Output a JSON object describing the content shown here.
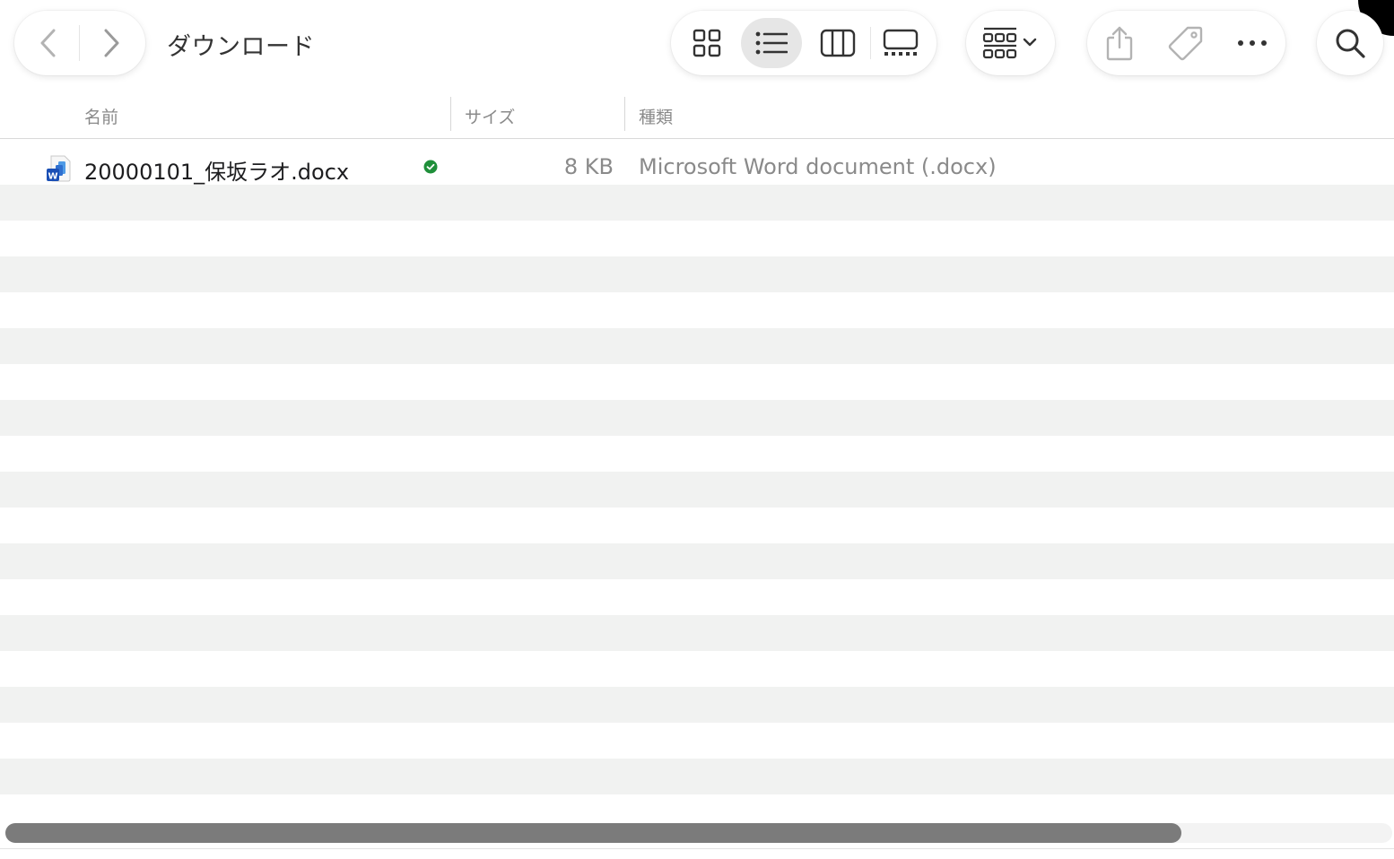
{
  "window": {
    "title": "ダウンロード"
  },
  "toolbar": {
    "back_icon": "chevron-left-icon",
    "forward_icon": "chevron-right-icon",
    "view_modes": [
      {
        "icon": "grid-view-icon",
        "selected": false
      },
      {
        "icon": "list-view-icon",
        "selected": true
      },
      {
        "icon": "column-view-icon",
        "selected": false
      },
      {
        "icon": "gallery-view-icon",
        "selected": false
      }
    ],
    "group_icon": "group-by-icon",
    "share_icon": "share-icon",
    "tag_icon": "tag-icon",
    "more_icon": "ellipsis-icon",
    "search_icon": "search-icon"
  },
  "columns": {
    "name": "名前",
    "size": "サイズ",
    "kind": "種類"
  },
  "files": [
    {
      "name": "20000101_保坂ラオ.docx",
      "size": "8 KB",
      "kind": "Microsoft Word document (.docx)",
      "icon": "word-document-icon",
      "status_icon": "synced-check-icon"
    }
  ],
  "colors": {
    "stripe": "#f1f2f1",
    "sync_green": "#1f8f3a",
    "word_blue": "#1a5fd0",
    "selected_view_bg": "#e6e6e6"
  }
}
